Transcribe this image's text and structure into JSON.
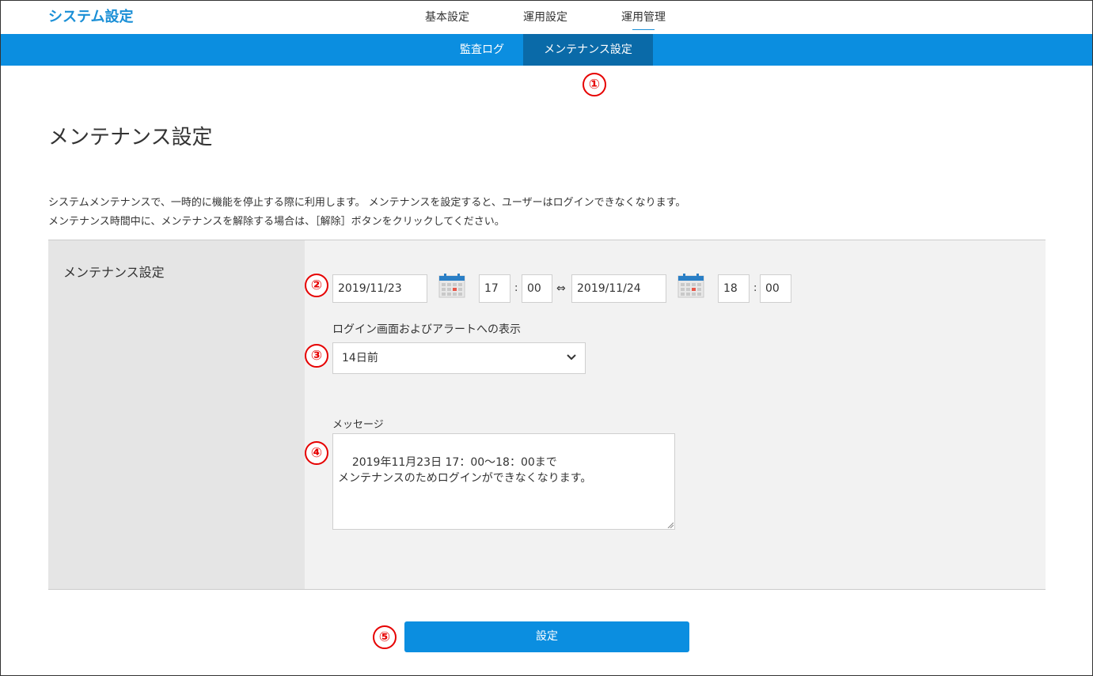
{
  "header": {
    "app_title": "システム設定",
    "nav": [
      {
        "label": "基本設定"
      },
      {
        "label": "運用設定"
      },
      {
        "label": "運用管理",
        "active": true
      }
    ]
  },
  "subnav": {
    "tabs": [
      {
        "label": "監査ログ"
      },
      {
        "label": "メンテナンス設定",
        "active": true
      }
    ]
  },
  "markers": [
    "①",
    "②",
    "③",
    "④",
    "⑤"
  ],
  "page": {
    "title": "メンテナンス設定",
    "description_line1": "システムメンテナンスで、一時的に機能を停止する際に利用します。 メンテナンスを設定すると、ユーザーはログインできなくなります。",
    "description_line2": "メンテナンス時間中に、メンテナンスを解除する場合は、［解除］ボタンをクリックしてください。"
  },
  "form": {
    "section_label": "メンテナンス設定",
    "start": {
      "date": "2019/11/23",
      "hour": "17",
      "minute": "00"
    },
    "range_separator": "⇔",
    "time_colon": ":",
    "end": {
      "date": "2019/11/24",
      "hour": "18",
      "minute": "00"
    },
    "display_label": "ログイン画面およびアラートへの表示",
    "display_selected": "14日前",
    "message_label": "メッセージ",
    "message_value": "2019年11月23日 17：00～18：00まで\nメンテナンスのためログインができなくなります。",
    "submit_label": "設定"
  },
  "colors": {
    "accent": "#0b8ee0",
    "accent_dark": "#0a6aa8",
    "marker_red": "#e60000"
  },
  "icons": {
    "calendar": "calendar-icon",
    "dropdown": "chevron-down-icon"
  }
}
